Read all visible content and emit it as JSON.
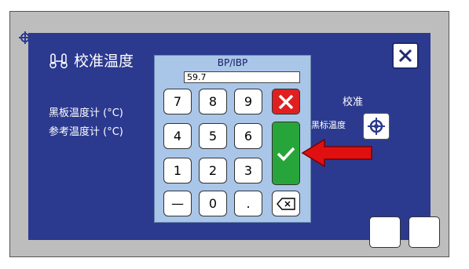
{
  "header": {
    "title": "校准温度"
  },
  "fields": {
    "black_panel_label": "黑板温度计 (°C)",
    "reference_label": "参考温度计 (°C)"
  },
  "right": {
    "calibrate_label": "校准",
    "black_temp_label": "黑标温度"
  },
  "keypad": {
    "title": "BP/IBP",
    "value": "59.7",
    "keys": [
      "7",
      "8",
      "9",
      "4",
      "5",
      "6",
      "1",
      "2",
      "3",
      "—",
      "0",
      "."
    ]
  },
  "icons": {
    "thermometer": "thermometer-icon",
    "close": "close-icon",
    "target": "crosshair-icon",
    "cancel": "x-icon",
    "confirm": "check-icon",
    "backspace": "backspace-icon",
    "arrow": "red-arrow-icon"
  },
  "colors": {
    "panel": "#2b3a8f",
    "keypad": "#a9c6e8",
    "cancel": "#e02020",
    "confirm": "#28a53a",
    "arrow": "#e01010"
  }
}
